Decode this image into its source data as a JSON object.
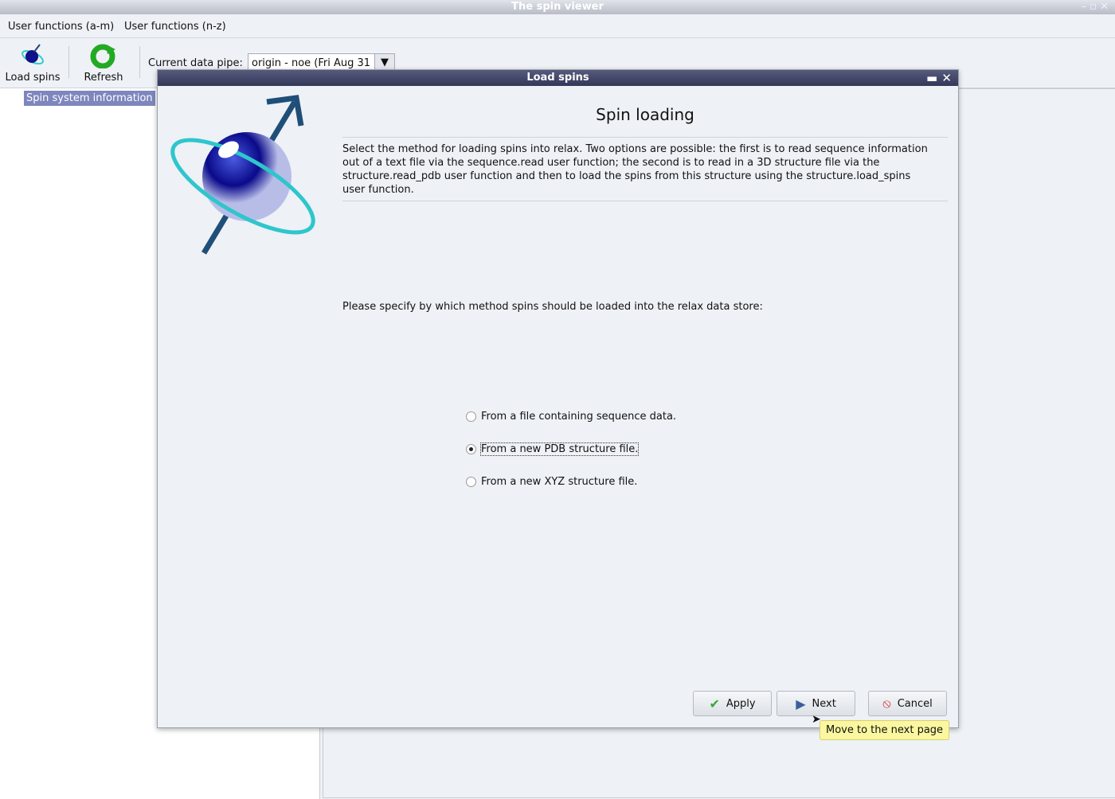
{
  "window": {
    "title": "The spin viewer"
  },
  "menu": [
    "User functions (a-m)",
    "User functions (n-z)"
  ],
  "toolbar": {
    "load_spins": "Load spins",
    "refresh": "Refresh",
    "pipe_label": "Current data pipe:",
    "pipe_value": "origin - noe (Fri Aug 31 1"
  },
  "tree": {
    "selected": "Spin system information"
  },
  "dialog": {
    "title": "Load spins",
    "heading": "Spin loading",
    "description": "Select the method for loading spins into relax.  Two options are possible: the first is to read sequence information out of a text file via the sequence.read user function; the second is to read in a 3D structure file via the structure.read_pdb user function and then to load the spins from this structure using the structure.load_spins user function.",
    "prompt": "Please specify by which method spins should be loaded into the relax data store:",
    "options": [
      {
        "label": "From a file containing sequence data.",
        "selected": false
      },
      {
        "label": "From a new PDB structure file.",
        "selected": true
      },
      {
        "label": "From a new XYZ structure file.",
        "selected": false
      }
    ],
    "buttons": {
      "apply": "Apply",
      "next": "Next",
      "cancel": "Cancel"
    },
    "tooltip": "Move to the next page"
  },
  "colors": {
    "selection": "#7d86bd",
    "dialog_title": "#3a3e60",
    "tooltip": "#fbf7a0"
  }
}
